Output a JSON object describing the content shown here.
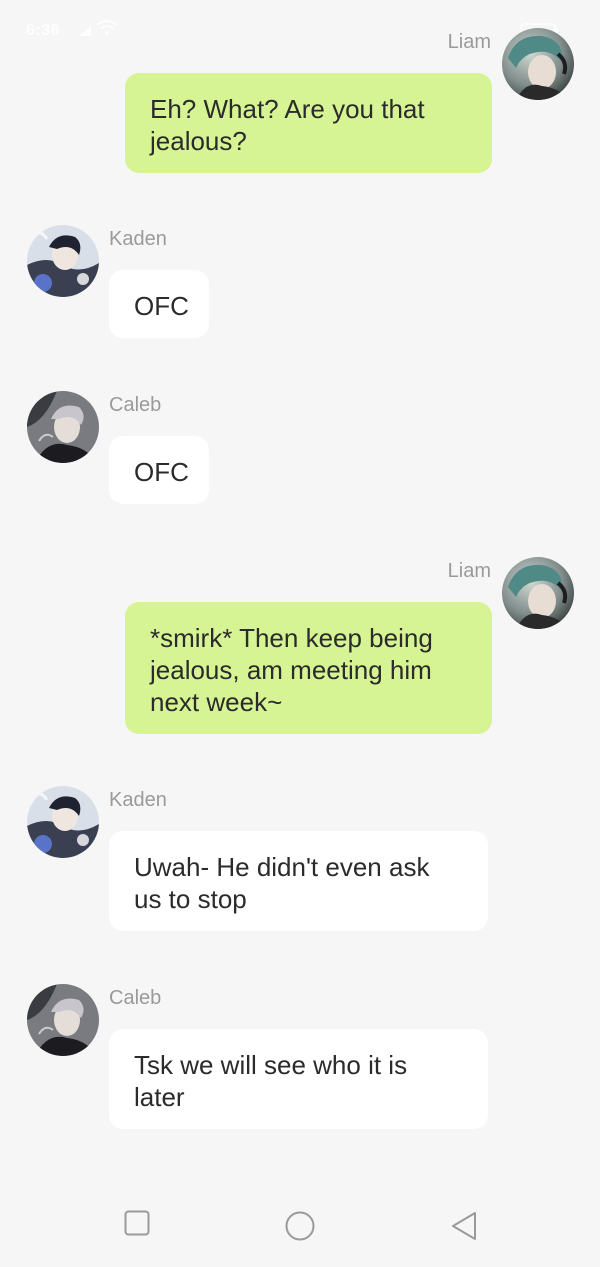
{
  "status_bar": {
    "time": "6:36"
  },
  "messages": [
    {
      "sender": "Liam",
      "direction": "outgoing",
      "text": "Eh? What? Are you that jealous?"
    },
    {
      "sender": "Kaden",
      "direction": "incoming",
      "text": "OFC"
    },
    {
      "sender": "Caleb",
      "direction": "incoming",
      "text": "OFC"
    },
    {
      "sender": "Liam",
      "direction": "outgoing",
      "text": "*smirk* Then keep being jealous, am meeting him next week~"
    },
    {
      "sender": "Kaden",
      "direction": "incoming",
      "text": "Uwah- He didn't even ask us to stop"
    },
    {
      "sender": "Caleb",
      "direction": "incoming",
      "text": "Tsk we will see who it is later"
    }
  ],
  "colors": {
    "background": "#f6f6f6",
    "outgoing_bubble": "#d7f494",
    "incoming_bubble": "#ffffff",
    "sender_name": "#9a9a9a",
    "message_text": "#2b2b2b"
  },
  "nav_bar": {
    "icons": [
      "recent-apps-icon",
      "home-icon",
      "back-icon"
    ]
  }
}
